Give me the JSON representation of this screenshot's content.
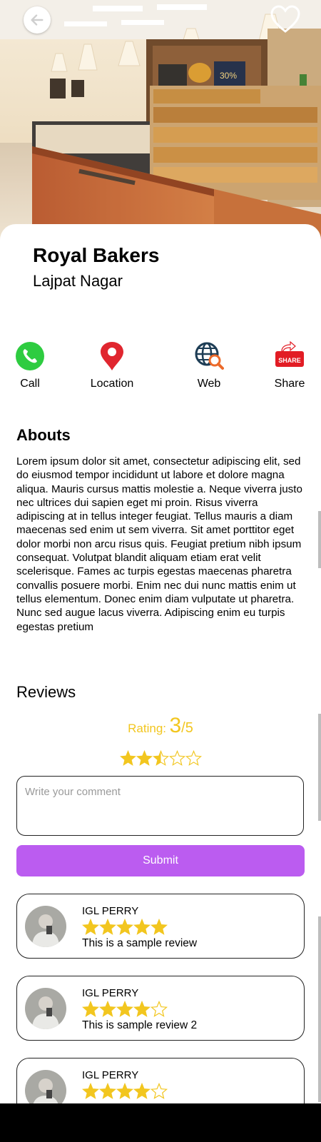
{
  "store": {
    "name": "Royal Bakers",
    "area": "Lajpat Nagar"
  },
  "hero": {
    "price_tag": "30%"
  },
  "actions": [
    {
      "label": "Call",
      "icon": "phone-icon"
    },
    {
      "label": "Location",
      "icon": "location-pin-icon"
    },
    {
      "label": "Web",
      "icon": "globe-search-icon"
    },
    {
      "label": "Share",
      "icon": "share-icon",
      "icon_text": "SHARE"
    }
  ],
  "about": {
    "heading": "Abouts",
    "text": "Lorem ipsum dolor sit amet, consectetur adipiscing elit, sed do eiusmod tempor incididunt ut labore et dolore magna aliqua. Mauris cursus mattis molestie a. Neque viverra justo nec ultrices dui sapien eget mi proin. Risus viverra adipiscing at in tellus integer feugiat. Tellus mauris a diam maecenas sed enim ut sem viverra. Sit amet porttitor eget dolor morbi non arcu risus quis. Feugiat pretium nibh ipsum consequat. Volutpat blandit aliquam etiam erat velit scelerisque. Fames ac turpis egestas maecenas pharetra convallis posuere morbi. Enim nec dui nunc mattis enim ut tellus elementum. Donec enim diam vulputate ut pharetra. Nunc sed augue lacus viverra. Adipiscing enim eu turpis egestas pretium"
  },
  "reviews_section": {
    "heading": "Reviews",
    "rating_label": "Rating:",
    "rating_value": "3",
    "rating_max": "/5",
    "rating_stars": 2.5,
    "comment_placeholder": "Write your comment",
    "submit_label": "Submit"
  },
  "reviews": [
    {
      "name": "IGL PERRY",
      "stars": 5,
      "text": "This is a sample review"
    },
    {
      "name": "IGL PERRY",
      "stars": 4,
      "text": "This is sample review 2"
    },
    {
      "name": "IGL PERRY",
      "stars": 4,
      "text": ""
    }
  ],
  "colors": {
    "accent": "#bb5cf0",
    "star": "#f2c61f",
    "rating_text": "#f2c61f",
    "call_green": "#2ecc40",
    "pin_red": "#e0262f"
  }
}
